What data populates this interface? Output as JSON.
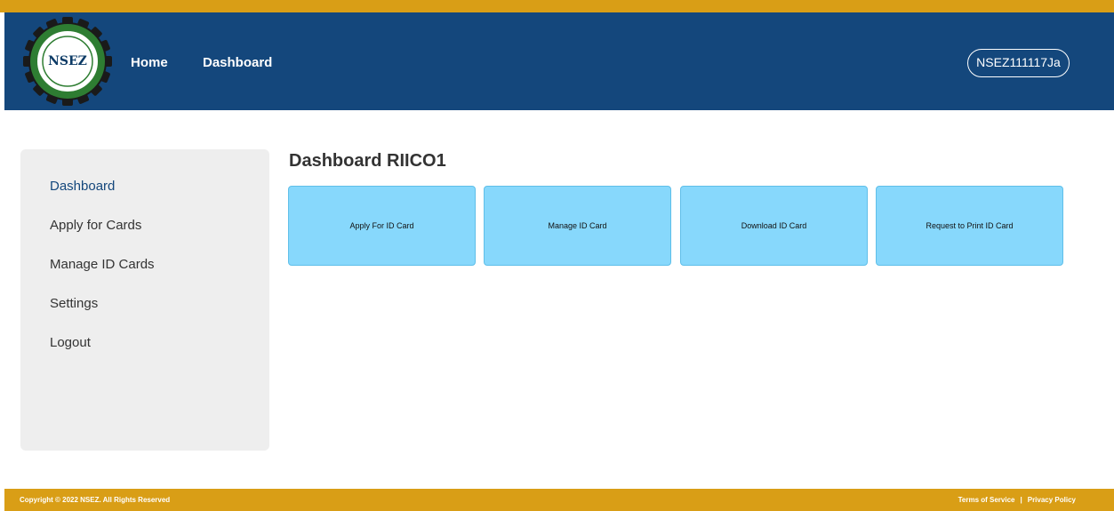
{
  "header": {
    "logo_text": "NSEZ",
    "nav": {
      "home": "Home",
      "dashboard": "Dashboard"
    },
    "user_id": "NSEZ111117Ja"
  },
  "sidebar": {
    "items": [
      {
        "label": "Dashboard"
      },
      {
        "label": "Apply for Cards"
      },
      {
        "label": "Manage ID Cards"
      },
      {
        "label": "Settings"
      },
      {
        "label": "Logout"
      }
    ]
  },
  "main": {
    "title": "Dashboard RIICO1",
    "cards": [
      {
        "label": "Apply For ID Card"
      },
      {
        "label": "Manage ID Card"
      },
      {
        "label": "Download ID Card"
      },
      {
        "label": "Request to Print ID Card"
      }
    ]
  },
  "footer": {
    "copyright": "Copyright © 2022 NSEZ. All Rights Reserved",
    "terms": "Terms of Service",
    "separator": "|",
    "privacy": "Privacy Policy"
  },
  "colors": {
    "header_bg": "#14477c",
    "accent_gold": "#d99e16",
    "card_bg": "#87d8fc",
    "sidebar_bg": "#eeeeee"
  }
}
